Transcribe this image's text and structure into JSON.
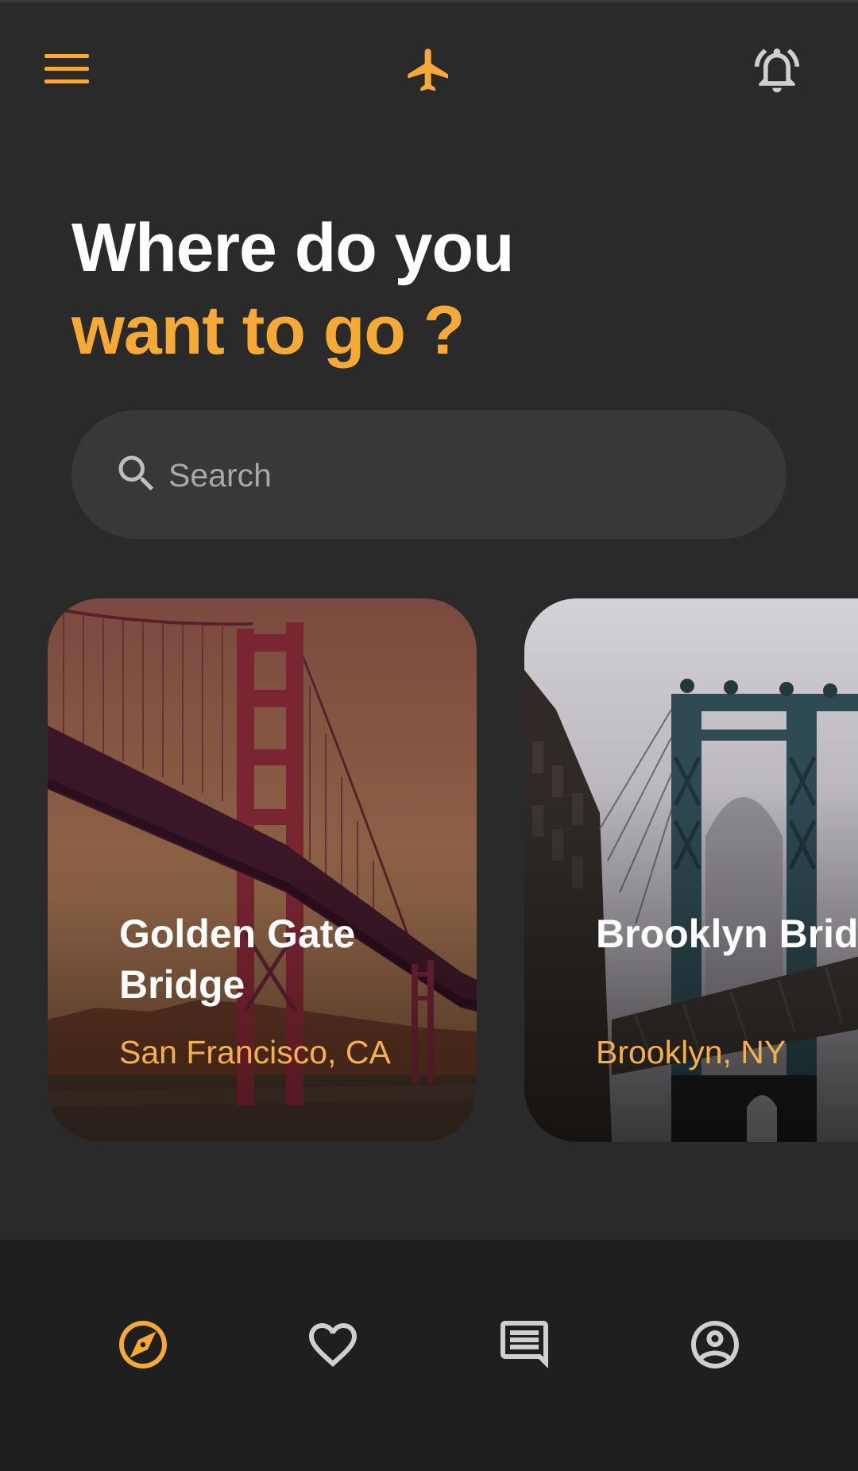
{
  "colors": {
    "background": "#2a2a2a",
    "accent": "#f6a935",
    "bottom_nav": "#1f1f1f",
    "search_bg": "#383838",
    "inactive_icon": "#cfcfcf"
  },
  "header": {
    "menu_icon": "hamburger-menu-icon",
    "logo_icon": "airplane-icon",
    "notification_icon": "bell-icon"
  },
  "heading": {
    "line1": "Where do you",
    "line2": "want to go ?"
  },
  "search": {
    "placeholder": "Search",
    "icon": "search-icon"
  },
  "destinations": [
    {
      "title": "Golden Gate Bridge",
      "location": "San Francisco, CA"
    },
    {
      "title": "Brooklyn Bridge",
      "location": "Brooklyn, NY"
    }
  ],
  "bottom_nav": {
    "items": [
      {
        "name": "explore",
        "icon": "compass-icon",
        "active": true
      },
      {
        "name": "favorites",
        "icon": "heart-icon",
        "active": false
      },
      {
        "name": "messages",
        "icon": "message-icon",
        "active": false
      },
      {
        "name": "profile",
        "icon": "account-circle-icon",
        "active": false
      }
    ]
  }
}
